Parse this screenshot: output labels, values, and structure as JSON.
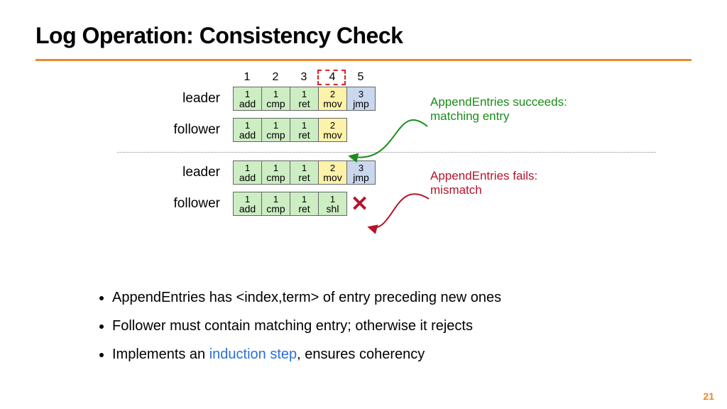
{
  "title": "Log Operation:  Consistency Check",
  "page": "21",
  "indices": [
    "1",
    "2",
    "3",
    "4",
    "5"
  ],
  "rows": {
    "leader1_label": "leader",
    "follower1_label": "follower",
    "leader2_label": "leader",
    "follower2_label": "follower"
  },
  "logs": {
    "leader1": [
      {
        "term": "1",
        "cmd": "add",
        "cls": "g"
      },
      {
        "term": "1",
        "cmd": "cmp",
        "cls": "g"
      },
      {
        "term": "1",
        "cmd": "ret",
        "cls": "g"
      },
      {
        "term": "2",
        "cmd": "mov",
        "cls": "y"
      },
      {
        "term": "3",
        "cmd": "jmp",
        "cls": "b"
      }
    ],
    "follower1": [
      {
        "term": "1",
        "cmd": "add",
        "cls": "g"
      },
      {
        "term": "1",
        "cmd": "cmp",
        "cls": "g"
      },
      {
        "term": "1",
        "cmd": "ret",
        "cls": "g"
      },
      {
        "term": "2",
        "cmd": "mov",
        "cls": "y"
      }
    ],
    "leader2": [
      {
        "term": "1",
        "cmd": "add",
        "cls": "g"
      },
      {
        "term": "1",
        "cmd": "cmp",
        "cls": "g"
      },
      {
        "term": "1",
        "cmd": "ret",
        "cls": "g"
      },
      {
        "term": "2",
        "cmd": "mov",
        "cls": "y"
      },
      {
        "term": "3",
        "cmd": "jmp",
        "cls": "b"
      }
    ],
    "follower2": [
      {
        "term": "1",
        "cmd": "add",
        "cls": "g"
      },
      {
        "term": "1",
        "cmd": "cmp",
        "cls": "g"
      },
      {
        "term": "1",
        "cmd": "ret",
        "cls": "g"
      },
      {
        "term": "1",
        "cmd": "shl",
        "cls": "g"
      }
    ]
  },
  "annot": {
    "success_l1": "AppendEntries succeeds:",
    "success_l2": "matching entry",
    "fail_l1": "AppendEntries fails:",
    "fail_l2": "mismatch"
  },
  "bullets": {
    "b1": "AppendEntries has <index,term> of entry preceding new ones",
    "b2": "Follower must contain matching entry; otherwise it rejects",
    "b3_a": "Implements an ",
    "b3_link": "induction step",
    "b3_b": ", ensures coherency"
  },
  "xmark": "✕"
}
